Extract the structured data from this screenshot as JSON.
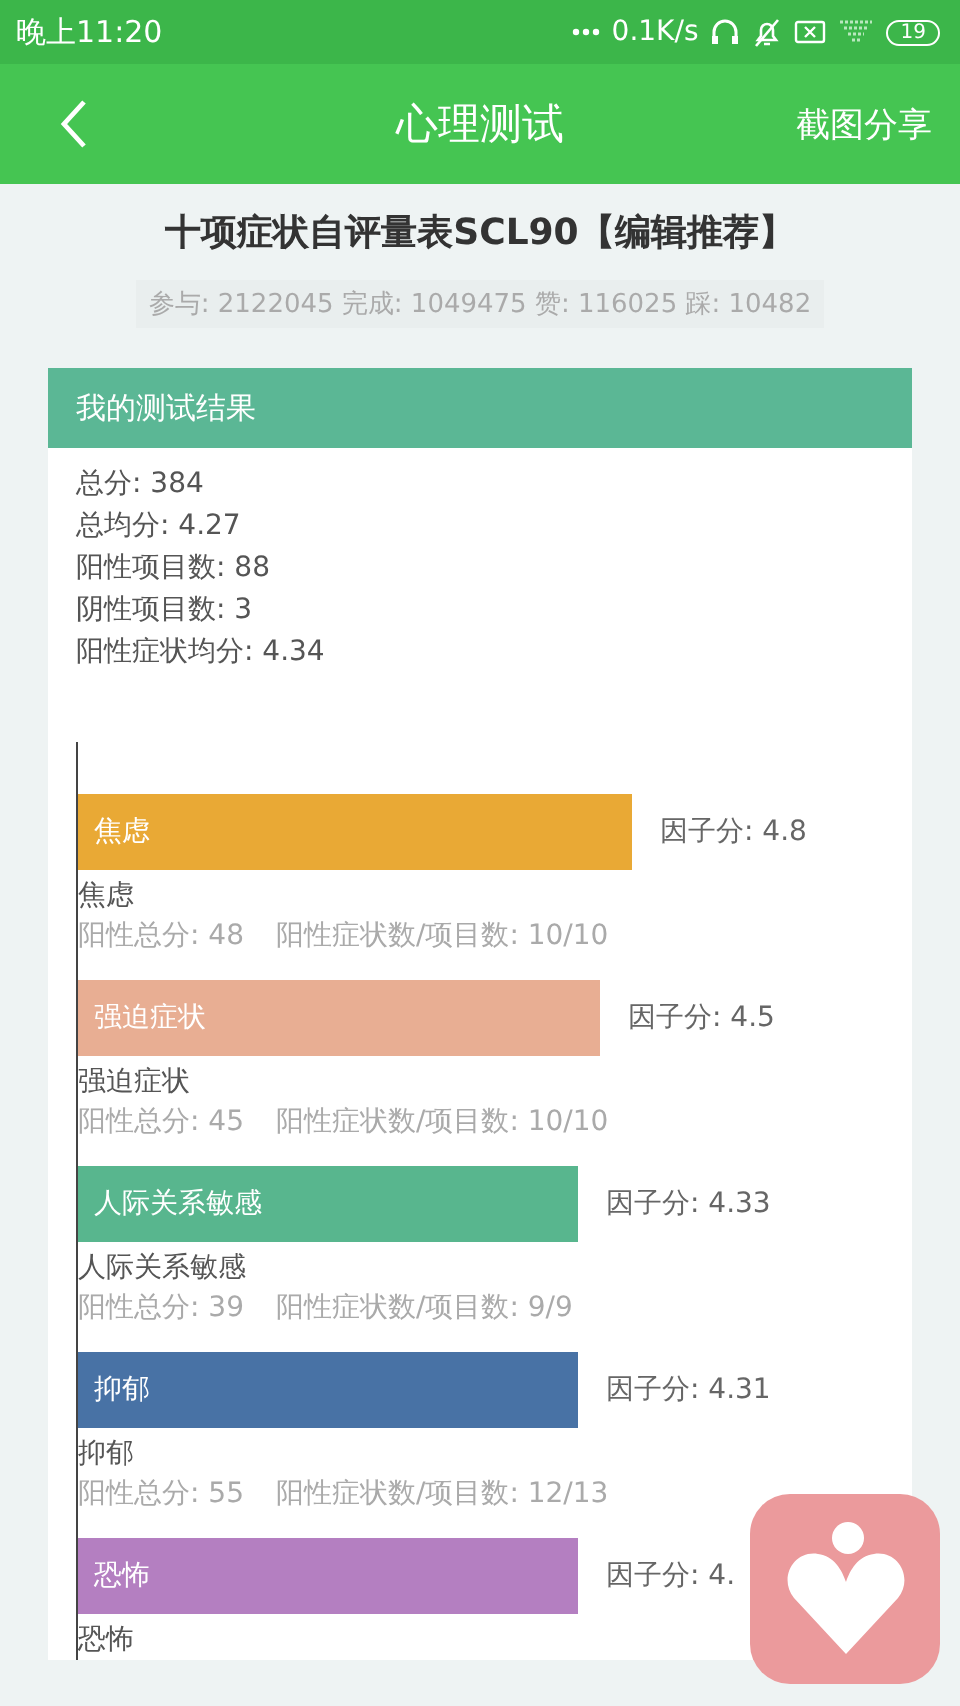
{
  "status_bar": {
    "time": "晚上11:20",
    "speed": "0.1K/s",
    "battery": "19"
  },
  "header": {
    "title": "心理测试",
    "action": "截图分享"
  },
  "test": {
    "title": "十项症状自评量表SCL90【编辑推荐】",
    "stats": "参与: 2122045 完成: 1049475 赞: 116025 踩: 10482"
  },
  "result": {
    "heading": "我的测试结果",
    "summary": [
      "总分: 384",
      "总均分: 4.27",
      "阳性项目数: 88",
      "阴性项目数: 3",
      "阳性症状均分: 4.34"
    ],
    "factors": [
      {
        "label": "焦虑",
        "score": "因子分: 4.8",
        "color": "#e9a935",
        "name": "焦虑",
        "positive_total": "阳性总分: 48",
        "ratio": "阳性症状数/项目数: 10/10"
      },
      {
        "label": "强迫症状",
        "score": "因子分: 4.5",
        "color": "#e8ae93",
        "name": "强迫症状",
        "positive_total": "阳性总分: 45",
        "ratio": "阳性症状数/项目数: 10/10"
      },
      {
        "label": "人际关系敏感",
        "score": "因子分: 4.33",
        "color": "#58b68e",
        "name": "人际关系敏感",
        "positive_total": "阳性总分: 39",
        "ratio": "阳性症状数/项目数: 9/9"
      },
      {
        "label": "抑郁",
        "score": "因子分: 4.31",
        "color": "#4872a5",
        "name": "抑郁",
        "positive_total": "阳性总分: 55",
        "ratio": "阳性症状数/项目数: 12/13"
      },
      {
        "label": "恐怖",
        "score": "因子分: 4.",
        "color": "#b47fc1",
        "name": "恐怖"
      }
    ]
  }
}
